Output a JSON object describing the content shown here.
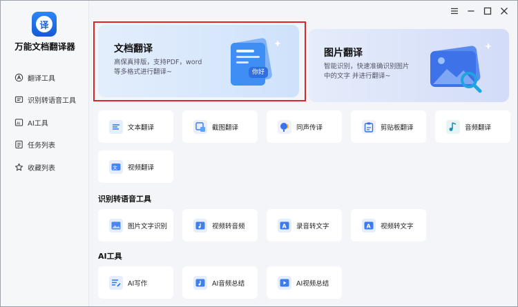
{
  "app": {
    "name": "万能文档翻译器",
    "logo_char": "译"
  },
  "sidebar": {
    "items": [
      {
        "label": "翻译工具",
        "icon": "translate-icon"
      },
      {
        "label": "识别转语音工具",
        "icon": "transcribe-icon"
      },
      {
        "label": "AI工具",
        "icon": "ai-icon"
      },
      {
        "label": "任务列表",
        "icon": "task-list-icon"
      },
      {
        "label": "收藏列表",
        "icon": "star-icon"
      }
    ]
  },
  "hero": {
    "doc": {
      "title": "文档翻译",
      "desc_line1": "高保真排版，支持PDF，word",
      "desc_line2": "等多格式进行翻译~",
      "badge": "你好"
    },
    "img": {
      "title": "图片翻译",
      "desc_line1": "智能识别，快速准确识别图片",
      "desc_line2": "中的文字 并进行翻译~"
    }
  },
  "translate_tools": [
    {
      "label": "文本翻译",
      "icon": "text-translate-icon"
    },
    {
      "label": "截图翻译",
      "icon": "screenshot-translate-icon"
    },
    {
      "label": "同声传译",
      "icon": "simultaneous-interpretation-icon"
    },
    {
      "label": "剪贴板翻译",
      "icon": "clipboard-translate-icon"
    },
    {
      "label": "音频翻译",
      "icon": "audio-translate-icon"
    },
    {
      "label": "视频翻译",
      "icon": "video-translate-icon"
    }
  ],
  "sections": {
    "recognition": "识别转语音工具",
    "ai": "AI工具"
  },
  "recognition_tools": [
    {
      "label": "图片文字识别",
      "icon": "image-ocr-icon"
    },
    {
      "label": "视频转音频",
      "icon": "video-to-audio-icon"
    },
    {
      "label": "录音转文字",
      "icon": "audio-to-text-icon"
    },
    {
      "label": "视频转文字",
      "icon": "video-to-text-icon"
    }
  ],
  "ai_tools": [
    {
      "label": "AI写作",
      "icon": "ai-writing-icon"
    },
    {
      "label": "AI音频总结",
      "icon": "ai-audio-summary-icon"
    },
    {
      "label": "AI视频总结",
      "icon": "ai-video-summary-icon"
    }
  ],
  "colors": {
    "accent": "#1f6ff0",
    "selection": "#d9262a",
    "background": "#f4f5f8"
  }
}
